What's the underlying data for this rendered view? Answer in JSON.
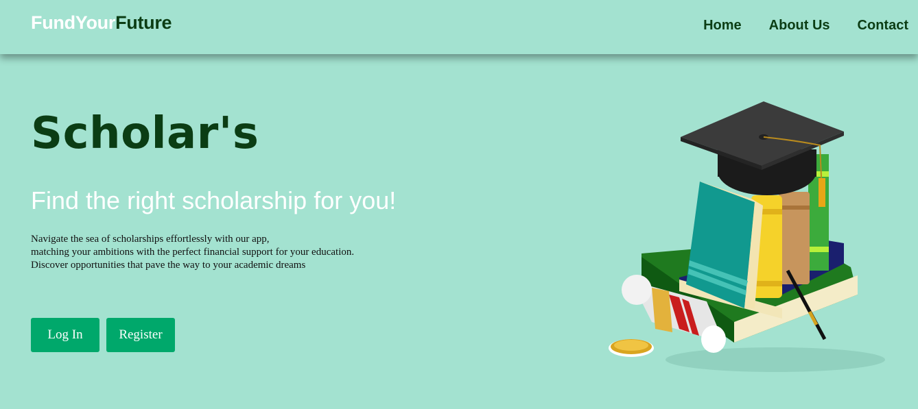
{
  "navbar": {
    "brand_part1": "FundYour",
    "brand_part2": "Future",
    "links": [
      "Home",
      "About Us",
      "Contact"
    ]
  },
  "hero": {
    "title": "Scholar's",
    "subtitle": "Find the right scholarship for you!",
    "description": [
      "Navigate the sea of scholarships effortlessly with our app,",
      "matching your ambitions with the perfect financial support for your education.",
      "Discover opportunities that pave the way to your academic dreams"
    ],
    "login_label": "Log In",
    "register_label": "Register"
  },
  "colors": {
    "background": "#a3e2d0",
    "dark_green": "#0b3d14",
    "button_green": "#00a86b"
  },
  "icons": [
    "graduation-books-illustration"
  ]
}
